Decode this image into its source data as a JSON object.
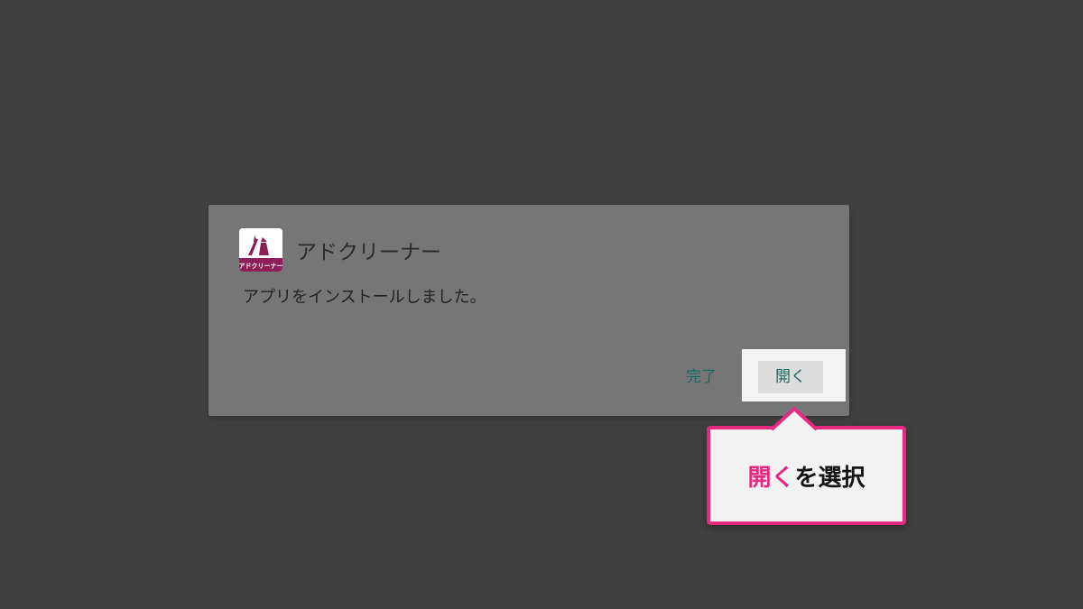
{
  "colors": {
    "backdrop": "#404040",
    "dialog_bg": "#767676",
    "button_text": "#17695f",
    "highlight_bg": "#f4f4f4",
    "accent": "#e5297f"
  },
  "dialog": {
    "app_icon": "adcleaner-app-icon",
    "app_icon_caption": "アドクリーナー",
    "app_name": "アドクリーナー",
    "message": "アプリをインストールしました。",
    "done_button": "完了",
    "open_button": "開く"
  },
  "callout": {
    "highlight": "開く",
    "rest": "を選択"
  }
}
